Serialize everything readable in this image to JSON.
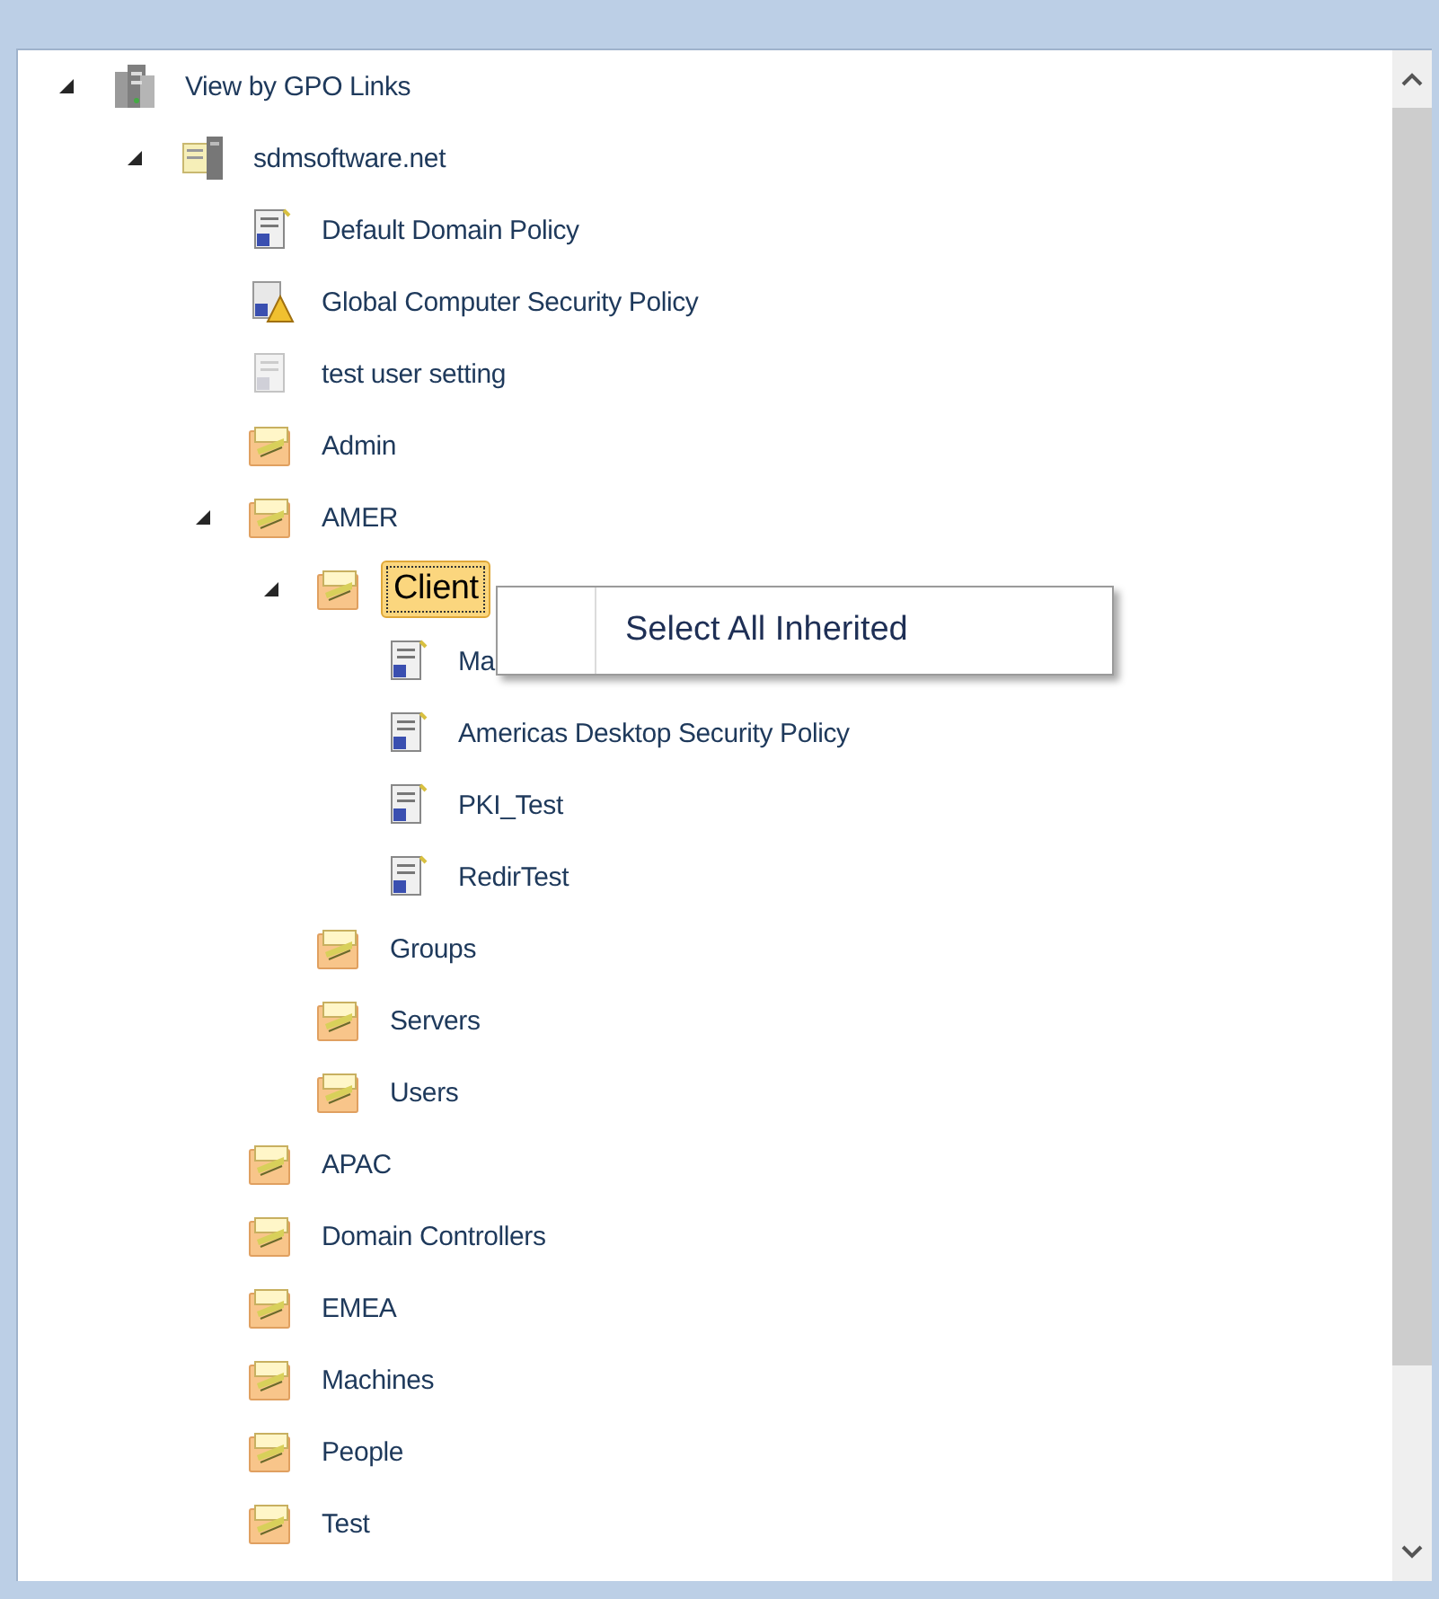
{
  "tree": [
    {
      "label": "View by GPO Links",
      "kind": "domain-root",
      "selected": false,
      "expanded": true,
      "children": [
        {
          "label": "sdmsoftware.net",
          "kind": "domain",
          "selected": false,
          "expanded": true,
          "children": [
            {
              "label": "Default Domain Policy",
              "kind": "gpo",
              "selected": false
            },
            {
              "label": "Global Computer Security Policy",
              "kind": "gpo-warning",
              "selected": false
            },
            {
              "label": "test user setting",
              "kind": "gpo-disabled",
              "selected": false
            },
            {
              "label": "Admin",
              "kind": "ou",
              "selected": false
            },
            {
              "label": "AMER",
              "kind": "ou",
              "selected": false,
              "expanded": true,
              "children": [
                {
                  "label": "Client",
                  "kind": "ou",
                  "selected": true,
                  "expanded": true,
                  "children": [
                    {
                      "label": "Ma",
                      "kind": "gpo",
                      "selected": false
                    },
                    {
                      "label": "Americas Desktop Security Policy",
                      "kind": "gpo",
                      "selected": false
                    },
                    {
                      "label": "PKI_Test",
                      "kind": "gpo",
                      "selected": false
                    },
                    {
                      "label": "RedirTest",
                      "kind": "gpo",
                      "selected": false
                    }
                  ]
                },
                {
                  "label": "Groups",
                  "kind": "ou",
                  "selected": false
                },
                {
                  "label": "Servers",
                  "kind": "ou",
                  "selected": false
                },
                {
                  "label": "Users",
                  "kind": "ou",
                  "selected": false
                }
              ]
            },
            {
              "label": "APAC",
              "kind": "ou",
              "selected": false
            },
            {
              "label": "Domain Controllers",
              "kind": "ou",
              "selected": false
            },
            {
              "label": "EMEA",
              "kind": "ou",
              "selected": false
            },
            {
              "label": "Machines",
              "kind": "ou",
              "selected": false
            },
            {
              "label": "People",
              "kind": "ou",
              "selected": false
            },
            {
              "label": "Test",
              "kind": "ou",
              "selected": false
            }
          ]
        }
      ]
    }
  ],
  "context_menu": {
    "items": [
      "Select All Inherited"
    ]
  }
}
